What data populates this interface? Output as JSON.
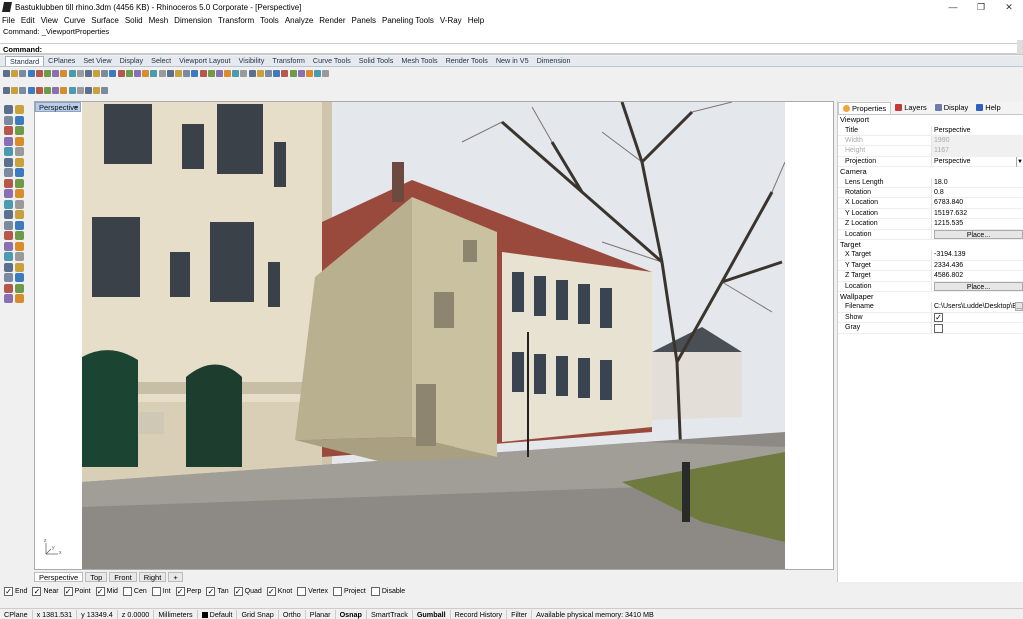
{
  "window": {
    "title": "Bastuklubben till rhino.3dm (4456 KB) - Rhinoceros  5.0 Corporate - [Perspective]",
    "minimize": "—",
    "restore": "❐",
    "close": "✕"
  },
  "menu": [
    "File",
    "Edit",
    "View",
    "Curve",
    "Surface",
    "Solid",
    "Mesh",
    "Dimension",
    "Transform",
    "Tools",
    "Analyze",
    "Render",
    "Panels",
    "Paneling Tools",
    "V-Ray",
    "Help"
  ],
  "command": {
    "history_label": "Command:",
    "history_value": "_ViewportProperties",
    "prompt_label": "Command:",
    "input_value": ""
  },
  "toolbar_tabs": [
    "Standard",
    "CPlanes",
    "Set View",
    "Display",
    "Select",
    "Viewport Layout",
    "Visibility",
    "Transform",
    "Curve Tools",
    "Solid Tools",
    "Mesh Tools",
    "Render Tools",
    "New in V5",
    "Dimension"
  ],
  "active_toolbar_tab": "Standard",
  "viewport": {
    "title": "Perspective",
    "axis_labels": {
      "x": "x",
      "y": "y",
      "z": "z"
    }
  },
  "view_tabs": [
    "Perspective",
    "Top",
    "Front",
    "Right",
    "+"
  ],
  "osnaps": [
    {
      "label": "End",
      "checked": true
    },
    {
      "label": "Near",
      "checked": true
    },
    {
      "label": "Point",
      "checked": true
    },
    {
      "label": "Mid",
      "checked": true
    },
    {
      "label": "Cen",
      "checked": false
    },
    {
      "label": "Int",
      "checked": false
    },
    {
      "label": "Perp",
      "checked": true
    },
    {
      "label": "Tan",
      "checked": true
    },
    {
      "label": "Quad",
      "checked": true
    },
    {
      "label": "Knot",
      "checked": true
    },
    {
      "label": "Vertex",
      "checked": false
    },
    {
      "label": "Project",
      "checked": false
    },
    {
      "label": "Disable",
      "checked": false
    }
  ],
  "status": {
    "cplane": "CPlane",
    "x": "x 1381.531",
    "y": "y 13349.4",
    "z": "z 0.0000",
    "units": "Millimeters",
    "layer": "Default",
    "grid_snap": "Grid Snap",
    "ortho": "Ortho",
    "planar": "Planar",
    "osnap": "Osnap",
    "smarttrack": "SmartTrack",
    "gumball": "Gumball",
    "record_history": "Record History",
    "filter": "Filter",
    "memory": "Available physical memory: 3410 MB"
  },
  "panel": {
    "tabs": [
      "Properties",
      "Layers",
      "Display",
      "Help"
    ],
    "sections": {
      "viewport": "Viewport",
      "camera": "Camera",
      "target": "Target",
      "wallpaper": "Wallpaper"
    },
    "viewport_props": {
      "title_k": "Title",
      "title_v": "Perspective",
      "width_k": "Width",
      "width_v": "1990",
      "height_k": "Height",
      "height_v": "1167",
      "projection_k": "Projection",
      "projection_v": "Perspective"
    },
    "camera_props": {
      "lens_k": "Lens Length",
      "lens_v": "18.0",
      "rotation_k": "Rotation",
      "rotation_v": "0.8",
      "xloc_k": "X Location",
      "xloc_v": "6783.840",
      "yloc_k": "Y Location",
      "yloc_v": "15197.632",
      "zloc_k": "Z Location",
      "zloc_v": "1215.535",
      "location_k": "Location",
      "location_btn": "Place..."
    },
    "target_props": {
      "xt_k": "X Target",
      "xt_v": "-3194.139",
      "yt_k": "Y Target",
      "yt_v": "2334.436",
      "zt_k": "Z Target",
      "zt_v": "4586.802",
      "location_k": "Location",
      "location_btn": "Place..."
    },
    "wallpaper_props": {
      "filename_k": "Filename",
      "filename_v": "C:\\Users\\Ludde\\Desktop\\B",
      "browse_btn": "...",
      "show_k": "Show",
      "show_checked": true,
      "gray_k": "Gray",
      "gray_checked": false
    }
  }
}
